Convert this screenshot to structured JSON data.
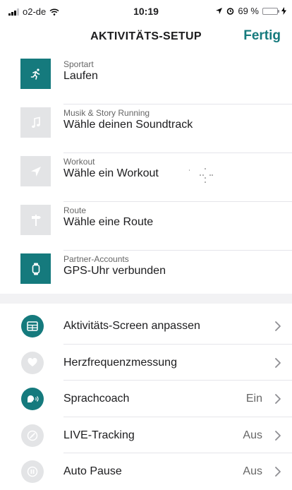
{
  "status_bar": {
    "carrier": "o2-de",
    "time": "10:19",
    "battery_percent": "69 %",
    "battery_level": 0.69
  },
  "nav": {
    "title": "AKTIVITÄTS-SETUP",
    "done_label": "Fertig"
  },
  "setup_items": [
    {
      "label": "Sportart",
      "value": "Laufen",
      "icon": "runner-icon",
      "active": true
    },
    {
      "label": "Musik & Story Running",
      "value": "Wähle deinen Soundtrack",
      "icon": "music-note-icon",
      "active": false
    },
    {
      "label": "Workout",
      "value": "Wähle ein Workout",
      "icon": "location-arrow-icon",
      "active": false
    },
    {
      "label": "Route",
      "value": "Wähle eine Route",
      "icon": "signpost-icon",
      "active": false
    },
    {
      "label": "Partner-Accounts",
      "value": "GPS-Uhr verbunden",
      "icon": "watch-icon",
      "active": true
    }
  ],
  "settings": [
    {
      "label": "Aktivitäts-Screen anpassen",
      "state": "",
      "icon": "screen-layout-icon",
      "active": true
    },
    {
      "label": "Herzfrequenzmessung",
      "state": "",
      "icon": "heart-icon",
      "active": false
    },
    {
      "label": "Sprachcoach",
      "state": "Ein",
      "icon": "voice-coach-icon",
      "active": true
    },
    {
      "label": "LIVE-Tracking",
      "state": "Aus",
      "icon": "live-tracking-icon",
      "active": false
    },
    {
      "label": "Auto Pause",
      "state": "Aus",
      "icon": "pause-icon",
      "active": false
    }
  ],
  "colors": {
    "accent": "#157a7d",
    "inactive_tile": "#e3e4e6",
    "battery": "#4cd964"
  }
}
